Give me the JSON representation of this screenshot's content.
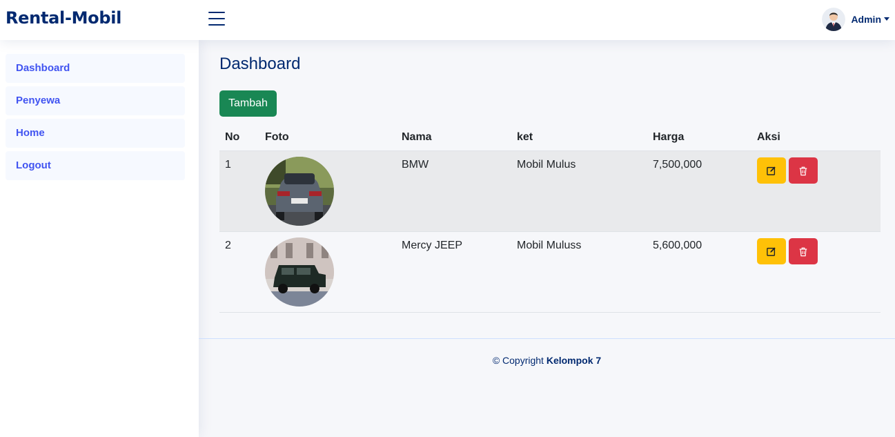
{
  "header": {
    "brand": "Rental-Mobil",
    "user_name": "Admin"
  },
  "sidebar": {
    "items": [
      {
        "label": "Dashboard"
      },
      {
        "label": "Penyewa"
      },
      {
        "label": "Home"
      },
      {
        "label": "Logout"
      }
    ]
  },
  "main": {
    "title": "Dashboard",
    "add_button": "Tambah",
    "columns": [
      "No",
      "Foto",
      "Nama",
      "ket",
      "Harga",
      "Aksi"
    ],
    "rows": [
      {
        "no": "1",
        "nama": "BMW",
        "ket": "Mobil Mulus",
        "harga": "7,500,000"
      },
      {
        "no": "2",
        "nama": "Mercy JEEP",
        "ket": "Mobil Muluss",
        "harga": "5,600,000"
      }
    ]
  },
  "footer": {
    "copyright_prefix": "© Copyright",
    "copyright_owner": "Kelompok 7"
  },
  "colors": {
    "brand": "#012970",
    "accent": "#4154f1",
    "add_button": "#198754",
    "edit_button": "#ffc107",
    "delete_button": "#dc3545"
  },
  "icons": {
    "menu": "hamburger-icon",
    "edit": "pencil-square-icon",
    "delete": "trash-icon"
  }
}
